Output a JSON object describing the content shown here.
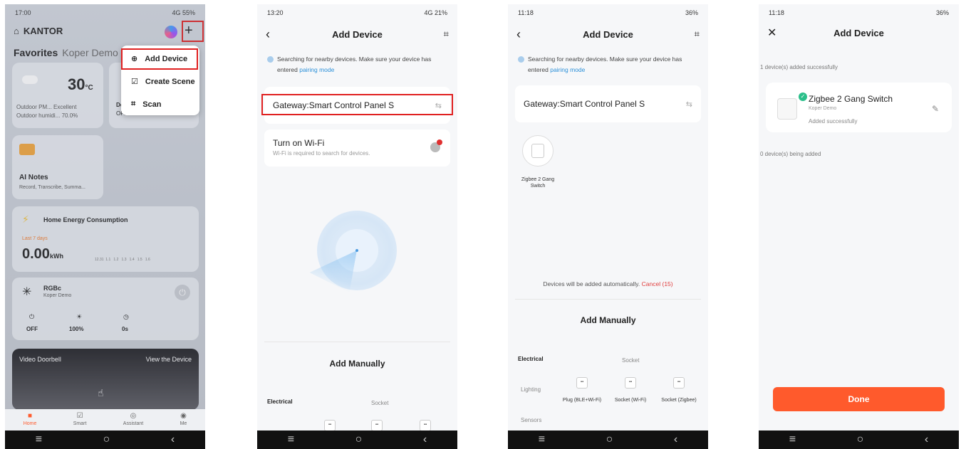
{
  "screen1": {
    "status_time": "17:00",
    "status_right": "4G 55%",
    "home_name": "KANTOR",
    "tab_favorites": "Favorites",
    "tab_other": "Koper Demo",
    "weather_temp": "30",
    "weather_unit": "°C",
    "outdoor_pm": "Outdoor PM... Excellent",
    "outdoor_humid": "Outdoor humidi... 70.0%",
    "small_card_text": "Do",
    "small_card_state": "OFF",
    "ai_title": "AI Notes",
    "ai_sub": "Record, Transcribe, Summa...",
    "energy_title": "Home Energy Consumption",
    "energy_period": "Last 7 days",
    "energy_value": "0.00",
    "energy_unit": "kWh",
    "energy_axis": "12.31  1.1   1.2   1.3   1.4   1.5   1.6",
    "rgb_title": "RGBc",
    "rgb_sub": "Koper Demo",
    "rgb_state": "OFF",
    "rgb_brightness": "100%",
    "rgb_timer": "0s",
    "doorbell_title": "Video Doorbell",
    "doorbell_link": "View the Device",
    "menu": {
      "add_device": "Add Device",
      "create_scene": "Create Scene",
      "scan": "Scan"
    },
    "tabbar": [
      "Home",
      "Smart",
      "Assistant",
      "Me"
    ]
  },
  "screen2": {
    "status_time": "13:20",
    "status_right": "4G 21%",
    "title": "Add Device",
    "searching": "Searching for nearby devices. Make sure your device has entered",
    "pairing_link": "pairing mode",
    "gateway": "Gateway:Smart Control Panel S",
    "wifi_title": "Turn on Wi-Fi",
    "wifi_sub": "Wi-Fi is required to search for devices.",
    "add_manually": "Add Manually",
    "electrical": "Electrical",
    "socket": "Socket"
  },
  "screen3": {
    "status_time": "11:18",
    "status_right": "36%",
    "title": "Add Device",
    "searching": "Searching for nearby devices. Make sure your device has entered",
    "pairing_link": "pairing mode",
    "gateway": "Gateway:Smart Control Panel S",
    "found_device": "Zigbee 2 Gang Switch",
    "auto_text": "Devices will be added automatically.",
    "cancel": "Cancel (15)",
    "add_manually": "Add Manually",
    "electrical": "Electrical",
    "lighting": "Lighting",
    "sensors": "Sensors",
    "socket": "Socket",
    "plug": "Plug (BLE+Wi-Fi)",
    "socket_wifi": "Socket (Wi-Fi)",
    "socket_zigbee": "Socket (Zigbee)"
  },
  "screen4": {
    "status_time": "11:18",
    "status_right": "36%",
    "title": "Add Device",
    "added_count": "1 device(s) added successfully",
    "device_name": "Zigbee 2 Gang Switch",
    "device_room": "Koper Demo",
    "device_status": "Added successfully",
    "being_added": "0 device(s) being added",
    "done": "Done"
  },
  "colors": {
    "accent_orange": "#ff5a2c",
    "link_blue": "#2a8fd8",
    "highlight_red": "#e02020",
    "success_green": "#2bbf8a"
  }
}
